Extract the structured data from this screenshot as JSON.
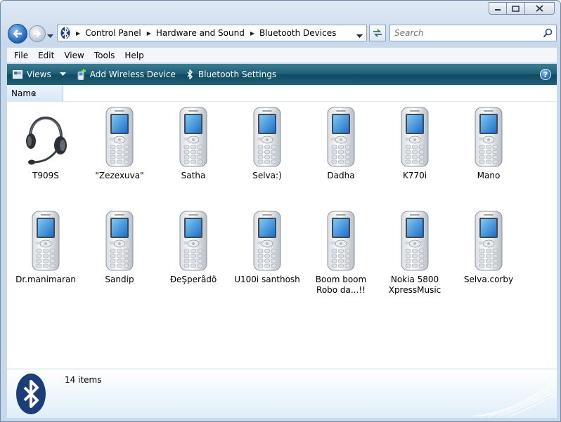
{
  "window": {
    "minimize_icon": "minimize-icon",
    "maximize_icon": "maximize-icon",
    "close_icon": "close-icon"
  },
  "address": {
    "crumbs": [
      "Control Panel",
      "Hardware and Sound",
      "Bluetooth Devices"
    ]
  },
  "search": {
    "placeholder": "Search"
  },
  "menu": [
    "File",
    "Edit",
    "View",
    "Tools",
    "Help"
  ],
  "commands": {
    "views": "Views",
    "add_device": "Add Wireless Device",
    "settings": "Bluetooth Settings",
    "help": "?"
  },
  "columns": {
    "name": "Name"
  },
  "devices": [
    {
      "name": "T909S",
      "type": "headset"
    },
    {
      "name": "\"Zezexuva\"",
      "type": "phone"
    },
    {
      "name": "Satha",
      "type": "phone"
    },
    {
      "name": "Selva:)",
      "type": "phone"
    },
    {
      "name": "Dadha",
      "type": "phone"
    },
    {
      "name": "K770i",
      "type": "phone"
    },
    {
      "name": "Mano",
      "type": "phone"
    },
    {
      "name": "Dr.manimaran",
      "type": "phone"
    },
    {
      "name": "Sandip",
      "type": "phone"
    },
    {
      "name": "ĐeŞperâdö",
      "type": "phone"
    },
    {
      "name": "U100i santhosh",
      "type": "phone"
    },
    {
      "name": "Boom boom Robo da...!!",
      "type": "phone"
    },
    {
      "name": "Nokia 5800 XpressMusic",
      "type": "phone"
    },
    {
      "name": "Selva.corby",
      "type": "phone"
    }
  ],
  "status": {
    "count": "14 items"
  },
  "colors": {
    "accent": "#1c5c73",
    "bluetooth": "#1b3d7a"
  }
}
